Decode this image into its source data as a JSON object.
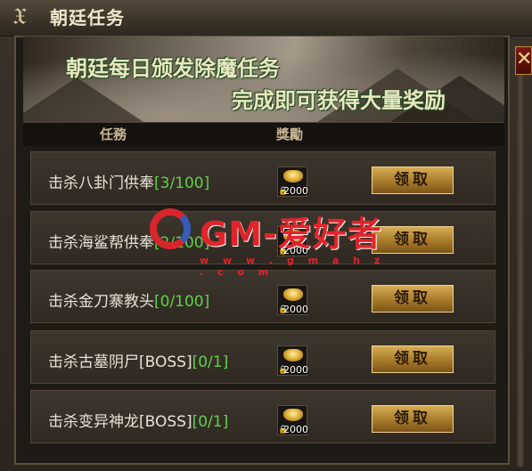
{
  "window": {
    "title": "朝廷任务",
    "emblem": "𝔛",
    "close_label": "✕"
  },
  "banner": {
    "line1": "朝廷每日颁发除魔任务",
    "line2": "完成即可获得大量奖励"
  },
  "columns": {
    "task": "任務",
    "reward": "獎勵"
  },
  "tasks": [
    {
      "name": "击杀八卦门供奉",
      "progress": "[3/100]",
      "reward_amount": "2000",
      "button": "领取"
    },
    {
      "name": "击杀海鲨帮供奉",
      "progress": "[2/100]",
      "reward_amount": "2000",
      "button": "领取"
    },
    {
      "name": "击杀金刀寨教头",
      "progress": "[0/100]",
      "reward_amount": "2000",
      "button": "领取"
    },
    {
      "name": "击杀古墓阴尸[BOSS]",
      "progress": "[0/1]",
      "reward_amount": "2000",
      "button": "领取"
    },
    {
      "name": "击杀变异神龙[BOSS]",
      "progress": "[0/1]",
      "reward_amount": "2000",
      "button": "领取"
    }
  ],
  "watermark": {
    "text": "GM-爱好者",
    "url": "w w w . g m a h z . c o m"
  },
  "colors": {
    "progress_green": "#5fd14a",
    "button_gold": "#c8963d",
    "title_text": "#f1e7cf"
  }
}
